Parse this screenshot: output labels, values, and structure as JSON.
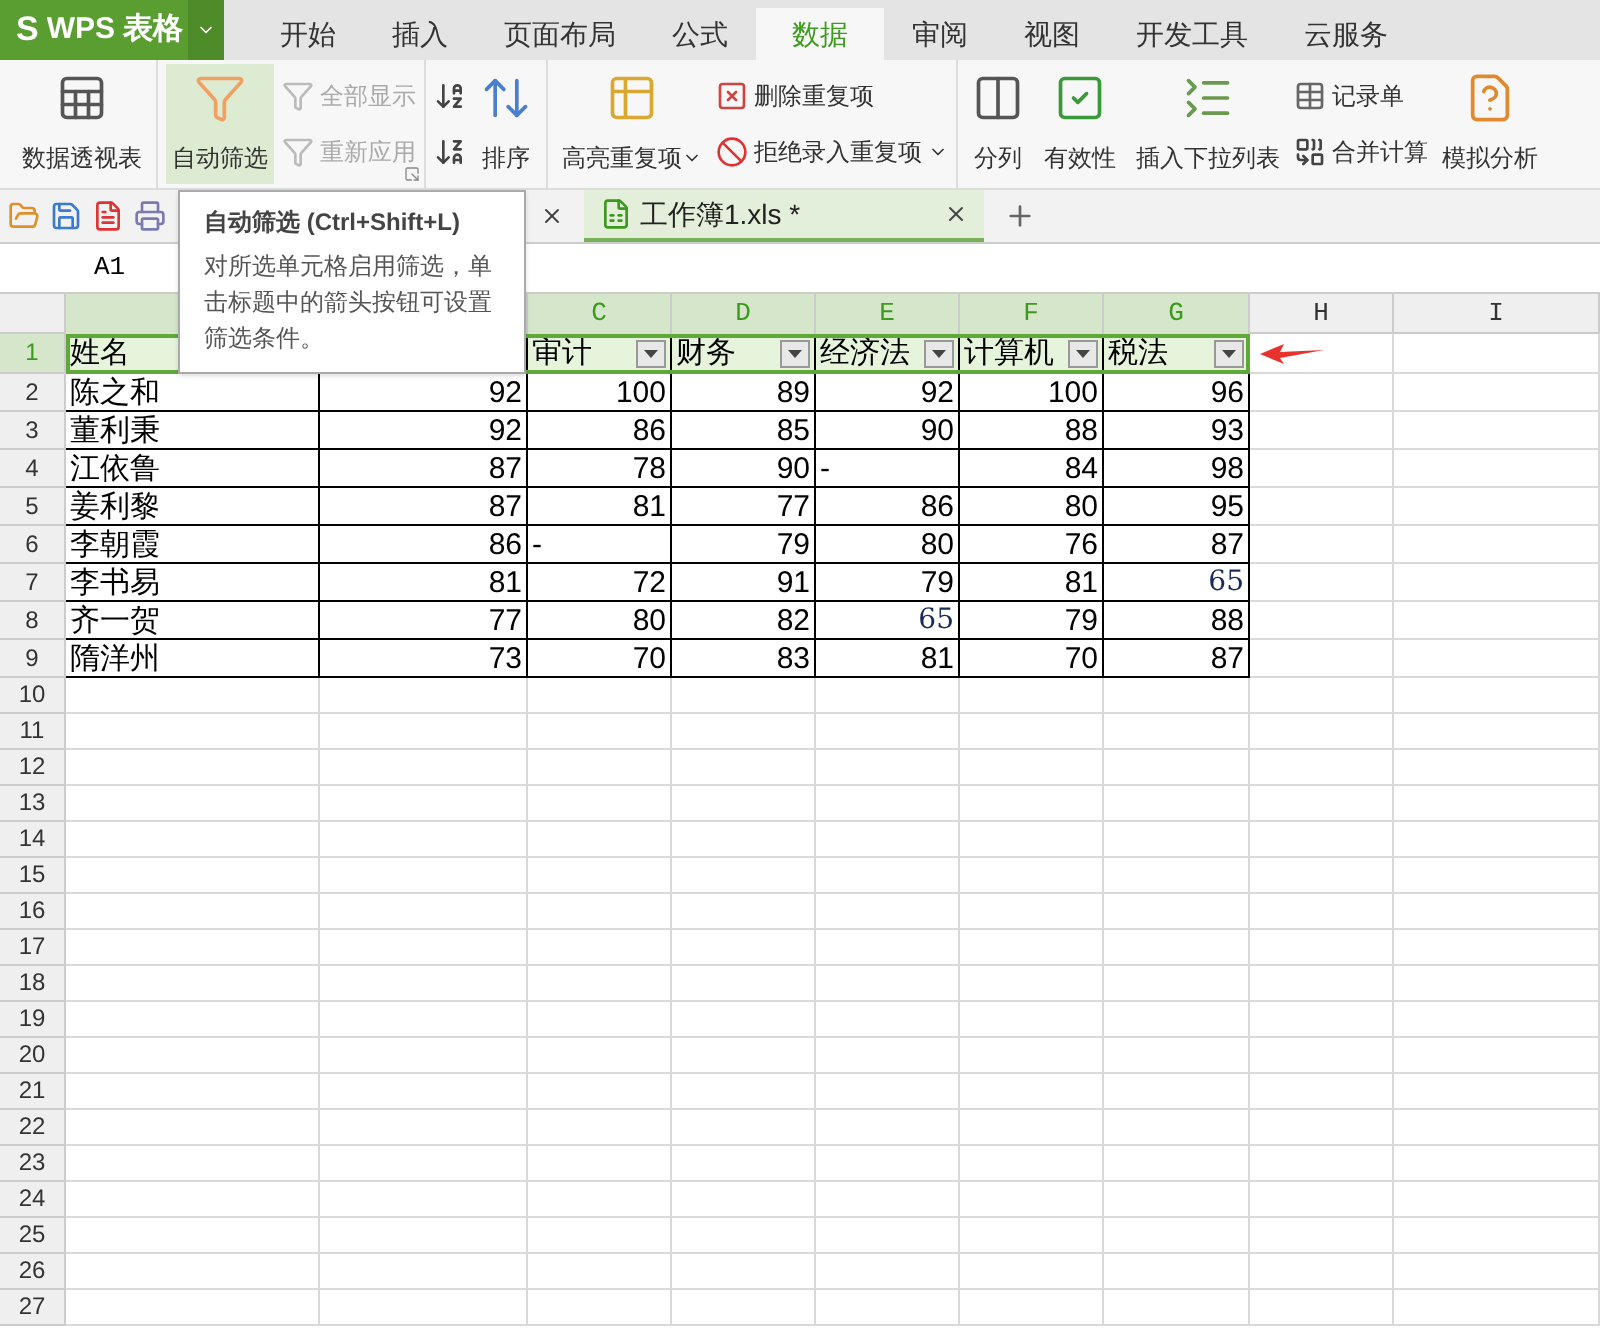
{
  "app": {
    "logo_letter": "S",
    "name": "WPS 表格"
  },
  "menu_tabs": [
    {
      "label": "开始",
      "selected": false
    },
    {
      "label": "插入",
      "selected": false
    },
    {
      "label": "页面布局",
      "selected": false
    },
    {
      "label": "公式",
      "selected": false
    },
    {
      "label": "数据",
      "selected": true
    },
    {
      "label": "审阅",
      "selected": false
    },
    {
      "label": "视图",
      "selected": false
    },
    {
      "label": "开发工具",
      "selected": false
    },
    {
      "label": "云服务",
      "selected": false
    }
  ],
  "ribbon_groups": [
    {
      "items": [
        {
          "kind": "large",
          "label": "数据透视表",
          "selected": false,
          "disabled": false,
          "has_menu": false
        }
      ]
    },
    {
      "items": [
        {
          "kind": "large",
          "label": "自动筛选",
          "selected": true,
          "disabled": false,
          "has_menu": false
        },
        {
          "kind": "stack",
          "items": [
            {
              "kind": "small",
              "label": "全部显示",
              "disabled": true,
              "has_menu": false
            },
            {
              "kind": "small",
              "label": "重新应用",
              "disabled": true,
              "has_menu": false
            }
          ]
        },
        {
          "kind": "launcher"
        }
      ]
    },
    {
      "items": [
        {
          "kind": "stack",
          "items": [
            {
              "kind": "icon",
              "disabled": false,
              "has_menu": false
            },
            {
              "kind": "icon",
              "disabled": false,
              "has_menu": false
            }
          ]
        },
        {
          "kind": "large",
          "label": "排序",
          "selected": false,
          "disabled": false,
          "has_menu": false
        }
      ]
    },
    {
      "items": [
        {
          "kind": "large",
          "label": "高亮重复项",
          "selected": false,
          "disabled": false,
          "has_menu": true
        },
        {
          "kind": "stack",
          "items": [
            {
              "kind": "small",
              "label": "删除重复项",
              "disabled": false,
              "has_menu": false
            },
            {
              "kind": "small",
              "label": "拒绝录入重复项",
              "disabled": false,
              "has_menu": true
            }
          ]
        }
      ]
    },
    {
      "items": [
        {
          "kind": "large",
          "label": "分列",
          "selected": false,
          "disabled": false,
          "has_menu": false
        },
        {
          "kind": "large",
          "label": "有效性",
          "selected": false,
          "disabled": false,
          "has_menu": false
        },
        {
          "kind": "large",
          "label": "插入下拉列表",
          "selected": false,
          "disabled": false,
          "has_menu": false
        },
        {
          "kind": "stack",
          "items": [
            {
              "kind": "small",
              "label": "记录单",
              "disabled": false,
              "has_menu": false
            },
            {
              "kind": "small",
              "label": "合并计算",
              "disabled": false,
              "has_menu": false
            }
          ]
        },
        {
          "kind": "large",
          "label": "模拟分析",
          "selected": false,
          "disabled": false,
          "has_menu": false
        }
      ]
    }
  ],
  "doc_tabs": [
    {
      "label": "工作簿1.xls *",
      "selected": true
    }
  ],
  "tooltip": {
    "title": "自动筛选 (Ctrl+Shift+L)",
    "body": "对所选单元格启用筛选，单击标题中的箭头按钮可设置筛选条件。"
  },
  "name_box": "A1",
  "column_headers": [
    {
      "selected": true
    },
    {
      "letter": "C",
      "selected": true
    },
    {
      "letter": "D",
      "selected": true
    },
    {
      "letter": "E",
      "selected": true
    },
    {
      "letter": "F",
      "selected": true
    },
    {
      "letter": "G",
      "selected": true
    },
    {
      "letter": "H",
      "selected": false
    },
    {
      "letter": "I",
      "selected": false
    }
  ],
  "header_row": [
    {
      "text": "姓名",
      "filter": false
    },
    {
      "text": "审计",
      "filter": true
    },
    {
      "text": "财务",
      "filter": true
    },
    {
      "text": "经济法",
      "filter": true
    },
    {
      "text": "计算机",
      "filter": true
    },
    {
      "text": "税法",
      "filter": true
    }
  ],
  "rows": [
    {
      "cells": [
        {
          "text": "陈之和",
          "kind": "text"
        },
        {
          "text": "92",
          "kind": "number"
        },
        {
          "text": "100",
          "kind": "number"
        },
        {
          "text": "89",
          "kind": "number"
        },
        {
          "text": "92",
          "kind": "number"
        },
        {
          "text": "100",
          "kind": "number"
        },
        {
          "text": "96",
          "kind": "number"
        }
      ]
    },
    {
      "cells": [
        {
          "text": "董利秉",
          "kind": "text"
        },
        {
          "text": "92",
          "kind": "number"
        },
        {
          "text": "86",
          "kind": "number"
        },
        {
          "text": "85",
          "kind": "number"
        },
        {
          "text": "90",
          "kind": "number"
        },
        {
          "text": "88",
          "kind": "number"
        },
        {
          "text": "93",
          "kind": "number"
        }
      ]
    },
    {
      "cells": [
        {
          "text": "江依鲁",
          "kind": "text"
        },
        {
          "text": "87",
          "kind": "number"
        },
        {
          "text": "78",
          "kind": "number"
        },
        {
          "text": "90",
          "kind": "number"
        },
        {
          "text": "-",
          "kind": "text"
        },
        {
          "text": "84",
          "kind": "number"
        },
        {
          "text": "98",
          "kind": "number"
        }
      ]
    },
    {
      "cells": [
        {
          "text": "姜利黎",
          "kind": "text"
        },
        {
          "text": "87",
          "kind": "number"
        },
        {
          "text": "81",
          "kind": "number"
        },
        {
          "text": "77",
          "kind": "number"
        },
        {
          "text": "86",
          "kind": "number"
        },
        {
          "text": "80",
          "kind": "number"
        },
        {
          "text": "95",
          "kind": "number"
        }
      ]
    },
    {
      "cells": [
        {
          "text": "李朝霞",
          "kind": "text"
        },
        {
          "text": "86",
          "kind": "number"
        },
        {
          "text": "-",
          "kind": "text"
        },
        {
          "text": "79",
          "kind": "number"
        },
        {
          "text": "80",
          "kind": "number"
        },
        {
          "text": "76",
          "kind": "number"
        },
        {
          "text": "87",
          "kind": "number"
        }
      ]
    },
    {
      "cells": [
        {
          "text": "李书易",
          "kind": "text"
        },
        {
          "text": "81",
          "kind": "number"
        },
        {
          "text": "72",
          "kind": "number"
        },
        {
          "text": "91",
          "kind": "number"
        },
        {
          "text": "79",
          "kind": "number"
        },
        {
          "text": "81",
          "kind": "number"
        },
        {
          "text": "65",
          "kind": "styled"
        }
      ]
    },
    {
      "cells": [
        {
          "text": "齐一贺",
          "kind": "text"
        },
        {
          "text": "77",
          "kind": "number"
        },
        {
          "text": "80",
          "kind": "number"
        },
        {
          "text": "82",
          "kind": "number"
        },
        {
          "text": "65",
          "kind": "styled"
        },
        {
          "text": "79",
          "kind": "number"
        },
        {
          "text": "88",
          "kind": "number"
        }
      ]
    },
    {
      "cells": [
        {
          "text": "隋洋州",
          "kind": "text"
        },
        {
          "text": "73",
          "kind": "number"
        },
        {
          "text": "70",
          "kind": "number"
        },
        {
          "text": "83",
          "kind": "number"
        },
        {
          "text": "81",
          "kind": "number"
        },
        {
          "text": "70",
          "kind": "number"
        },
        {
          "text": "87",
          "kind": "number"
        }
      ]
    }
  ],
  "row_numbers": [
    {
      "label": "1",
      "selected": true
    },
    {
      "label": "2",
      "selected": false
    },
    {
      "label": "3",
      "selected": false
    },
    {
      "label": "4",
      "selected": false
    },
    {
      "label": "5",
      "selected": false
    },
    {
      "label": "6",
      "selected": false
    },
    {
      "label": "7",
      "selected": false
    },
    {
      "label": "8",
      "selected": false
    },
    {
      "label": "9",
      "selected": false
    },
    {
      "label": "10",
      "selected": false
    },
    {
      "label": "11",
      "selected": false
    },
    {
      "label": "12",
      "selected": false
    },
    {
      "label": "13",
      "selected": false
    },
    {
      "label": "14",
      "selected": false
    },
    {
      "label": "15",
      "selected": false
    },
    {
      "label": "16",
      "selected": false
    },
    {
      "label": "17",
      "selected": false
    },
    {
      "label": "18",
      "selected": false
    },
    {
      "label": "19",
      "selected": false
    },
    {
      "label": "20",
      "selected": false
    },
    {
      "label": "21",
      "selected": false
    },
    {
      "label": "22",
      "selected": false
    },
    {
      "label": "23",
      "selected": false
    },
    {
      "label": "24",
      "selected": false
    },
    {
      "label": "25",
      "selected": false
    },
    {
      "label": "26",
      "selected": false
    },
    {
      "label": "27",
      "selected": false
    }
  ]
}
